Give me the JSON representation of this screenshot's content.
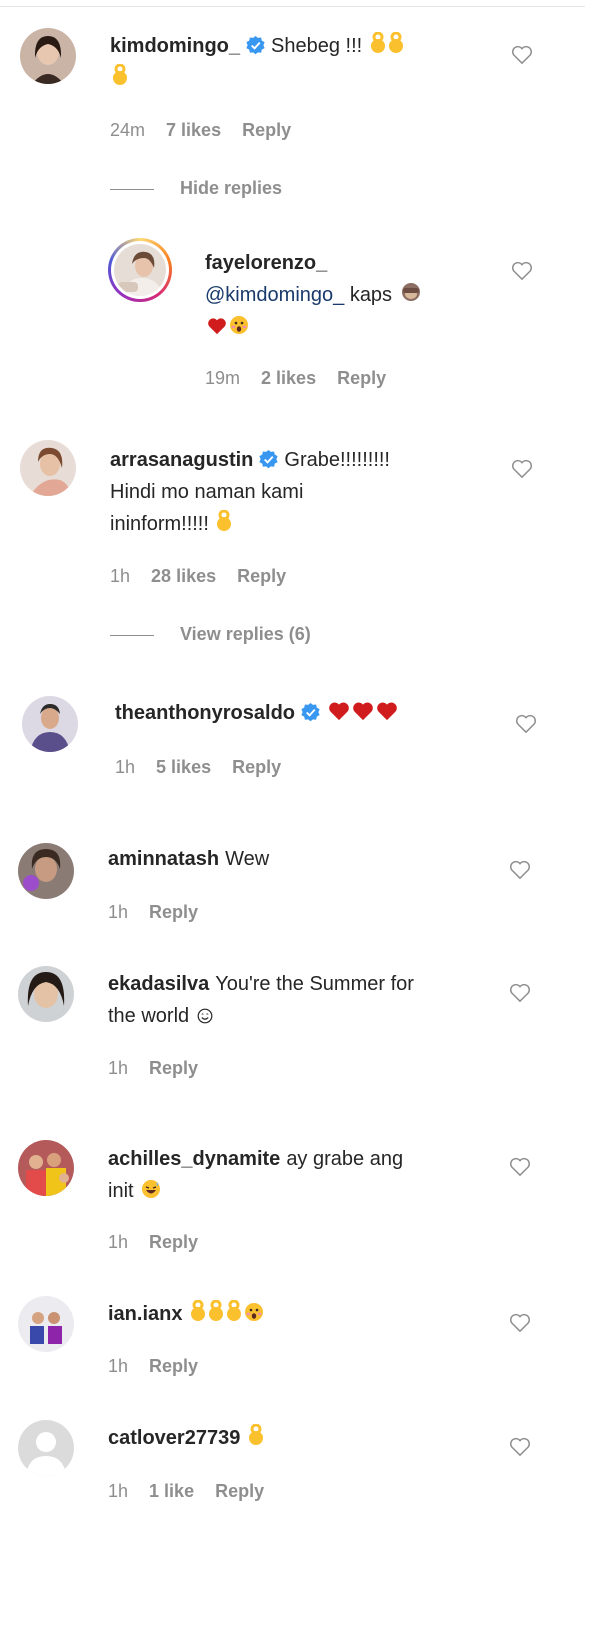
{
  "comments": [
    {
      "username": "kimdomingo_",
      "text_parts": [
        "Shebeg !!!"
      ],
      "time": "24m",
      "likes": "7 likes",
      "reply": "Reply",
      "toggle": "Hide replies",
      "emojis": [
        "ok-hand",
        "ok-hand",
        "ok-hand"
      ]
    },
    {
      "username": "fayelorenzo_",
      "mention": "@kimdomingo_",
      "text_parts": [
        "kaps"
      ],
      "time": "19m",
      "likes": "2 likes",
      "reply": "Reply",
      "emojis": [
        "see-no-evil-monkey",
        "red-heart",
        "astonished-face"
      ]
    },
    {
      "username": "arrasanagustin",
      "text_parts": [
        "Grabe!!!!!!!!!",
        "Hindi mo naman kami",
        "ininform!!!!!"
      ],
      "time": "1h",
      "likes": "28 likes",
      "reply": "Reply",
      "toggle": "View replies (6)",
      "emojis": [
        "ok-hand"
      ]
    },
    {
      "username": "theanthonyrosaldo",
      "text_parts": [],
      "time": "1h",
      "likes": "5 likes",
      "reply": "Reply",
      "emojis": [
        "red-heart",
        "red-heart",
        "red-heart"
      ]
    },
    {
      "username": "aminnatash",
      "text_parts": [
        "Wew"
      ],
      "time": "1h",
      "reply": "Reply"
    },
    {
      "username": "ekadasilva",
      "text_parts": [
        "You're the Summer for",
        "the world"
      ],
      "time": "1h",
      "reply": "Reply",
      "emojis": [
        "smiling-face"
      ]
    },
    {
      "username": "achilles_dynamite",
      "text_parts": [
        "ay grabe ang",
        "init"
      ],
      "time": "1h",
      "reply": "Reply",
      "emojis": [
        "grinning-sweat-face"
      ]
    },
    {
      "username": "ian.ianx",
      "text_parts": [],
      "time": "1h",
      "reply": "Reply",
      "emojis": [
        "ok-hand",
        "ok-hand",
        "ok-hand",
        "astonished-face"
      ]
    },
    {
      "username": "catlover27739",
      "text_parts": [],
      "time": "1h",
      "likes": "1 like",
      "reply": "Reply",
      "emojis": [
        "ok-hand"
      ]
    }
  ],
  "colors": {
    "text": "#262626",
    "meta": "#8e8e8e",
    "verified": "#3897f0",
    "heart_red": "#d01c1c",
    "ok_hand": "#fbc02d"
  }
}
